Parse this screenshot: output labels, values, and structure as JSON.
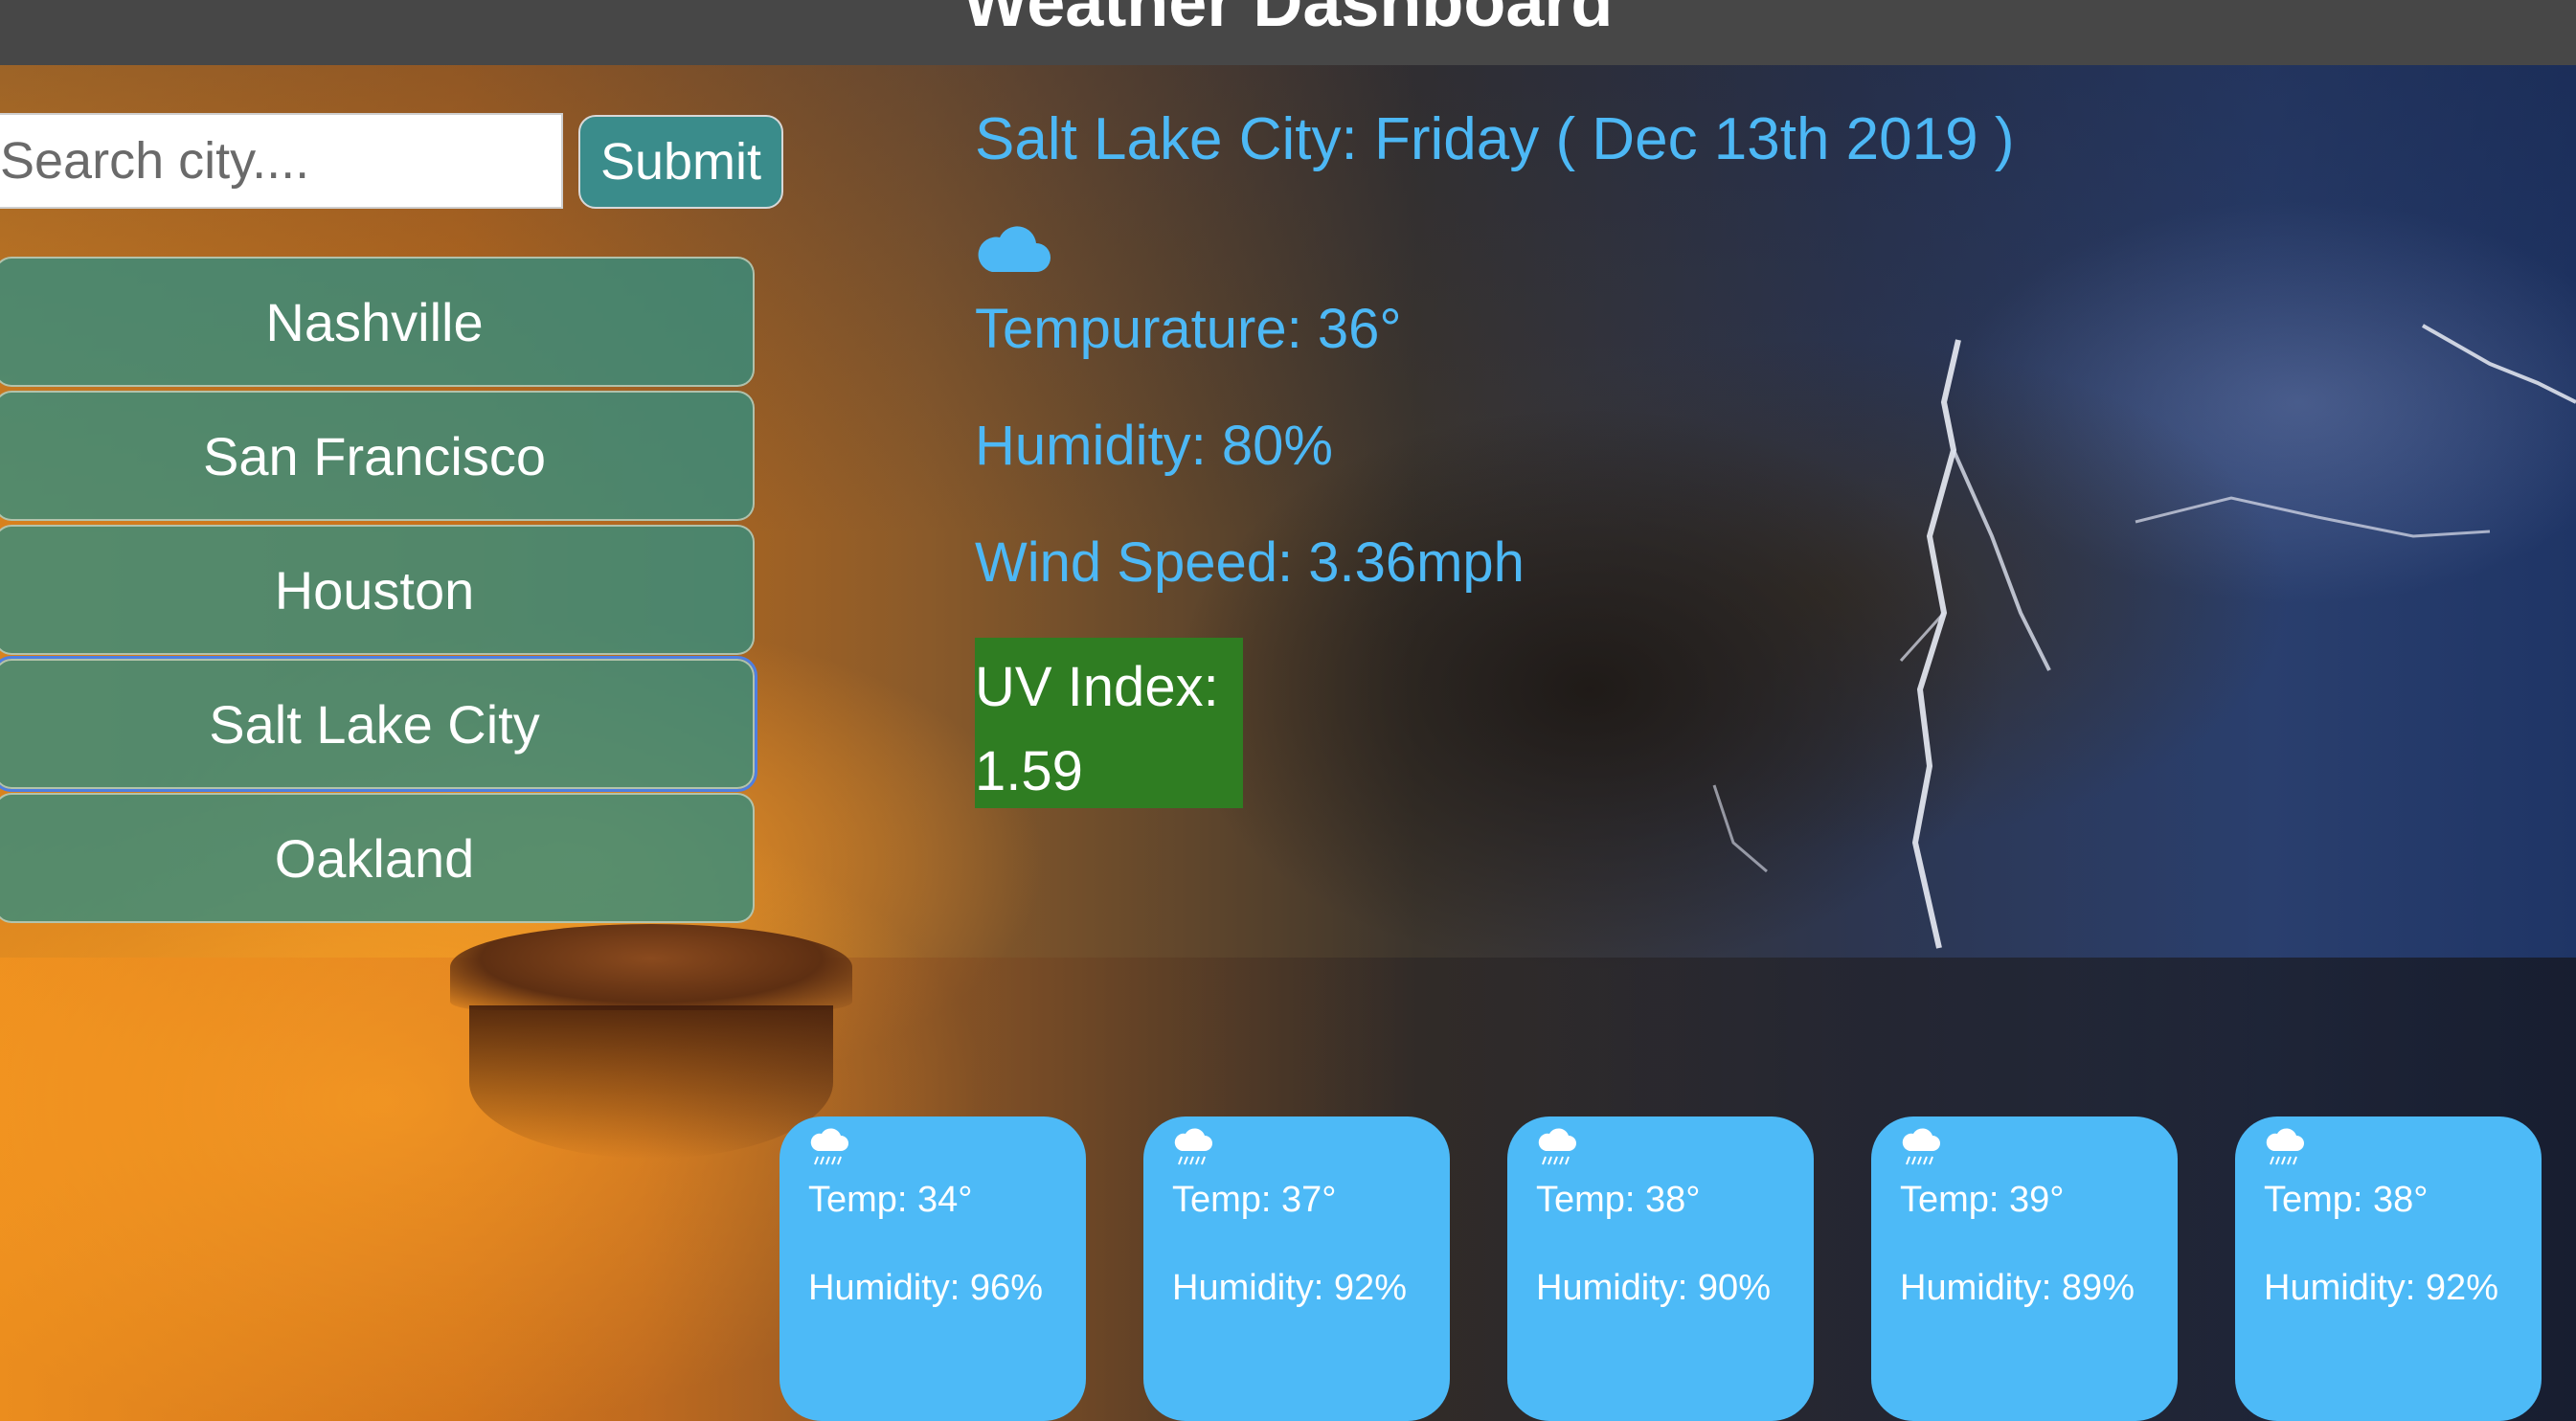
{
  "header": {
    "title": "Weather Dashboard"
  },
  "search": {
    "placeholder": "Search city....",
    "value": "",
    "submit_label": "Submit"
  },
  "cities": [
    {
      "label": "Nashville"
    },
    {
      "label": "San Francisco"
    },
    {
      "label": "Houston"
    },
    {
      "label": "Salt Lake City"
    },
    {
      "label": "Oakland"
    }
  ],
  "current": {
    "title": "Salt Lake City: Friday ( Dec 13th 2019 )",
    "icon": "cloud-icon",
    "temperature": "Tempurature: 36°",
    "humidity": "Humidity: 80%",
    "wind": "Wind Speed: 3.36mph",
    "uv_label": "UV Index:",
    "uv_value": "1.59"
  },
  "forecast": [
    {
      "icon": "rain-cloud-icon",
      "temp": "Temp: 34°",
      "humidity": "Humidity: 96%"
    },
    {
      "icon": "rain-cloud-icon",
      "temp": "Temp: 37°",
      "humidity": "Humidity: 92%"
    },
    {
      "icon": "rain-cloud-icon",
      "temp": "Temp: 38°",
      "humidity": "Humidity: 90%"
    },
    {
      "icon": "rain-cloud-icon",
      "temp": "Temp: 39°",
      "humidity": "Humidity: 89%"
    },
    {
      "icon": "rain-cloud-icon",
      "temp": "Temp: 38°",
      "humidity": "Humidity: 92%"
    }
  ],
  "colors": {
    "header_bg": "#474747",
    "accent_text": "#4db8f5",
    "city_button": "#388c7c",
    "uv_badge": "#2f7d22",
    "forecast_card": "#4dbaf7"
  }
}
